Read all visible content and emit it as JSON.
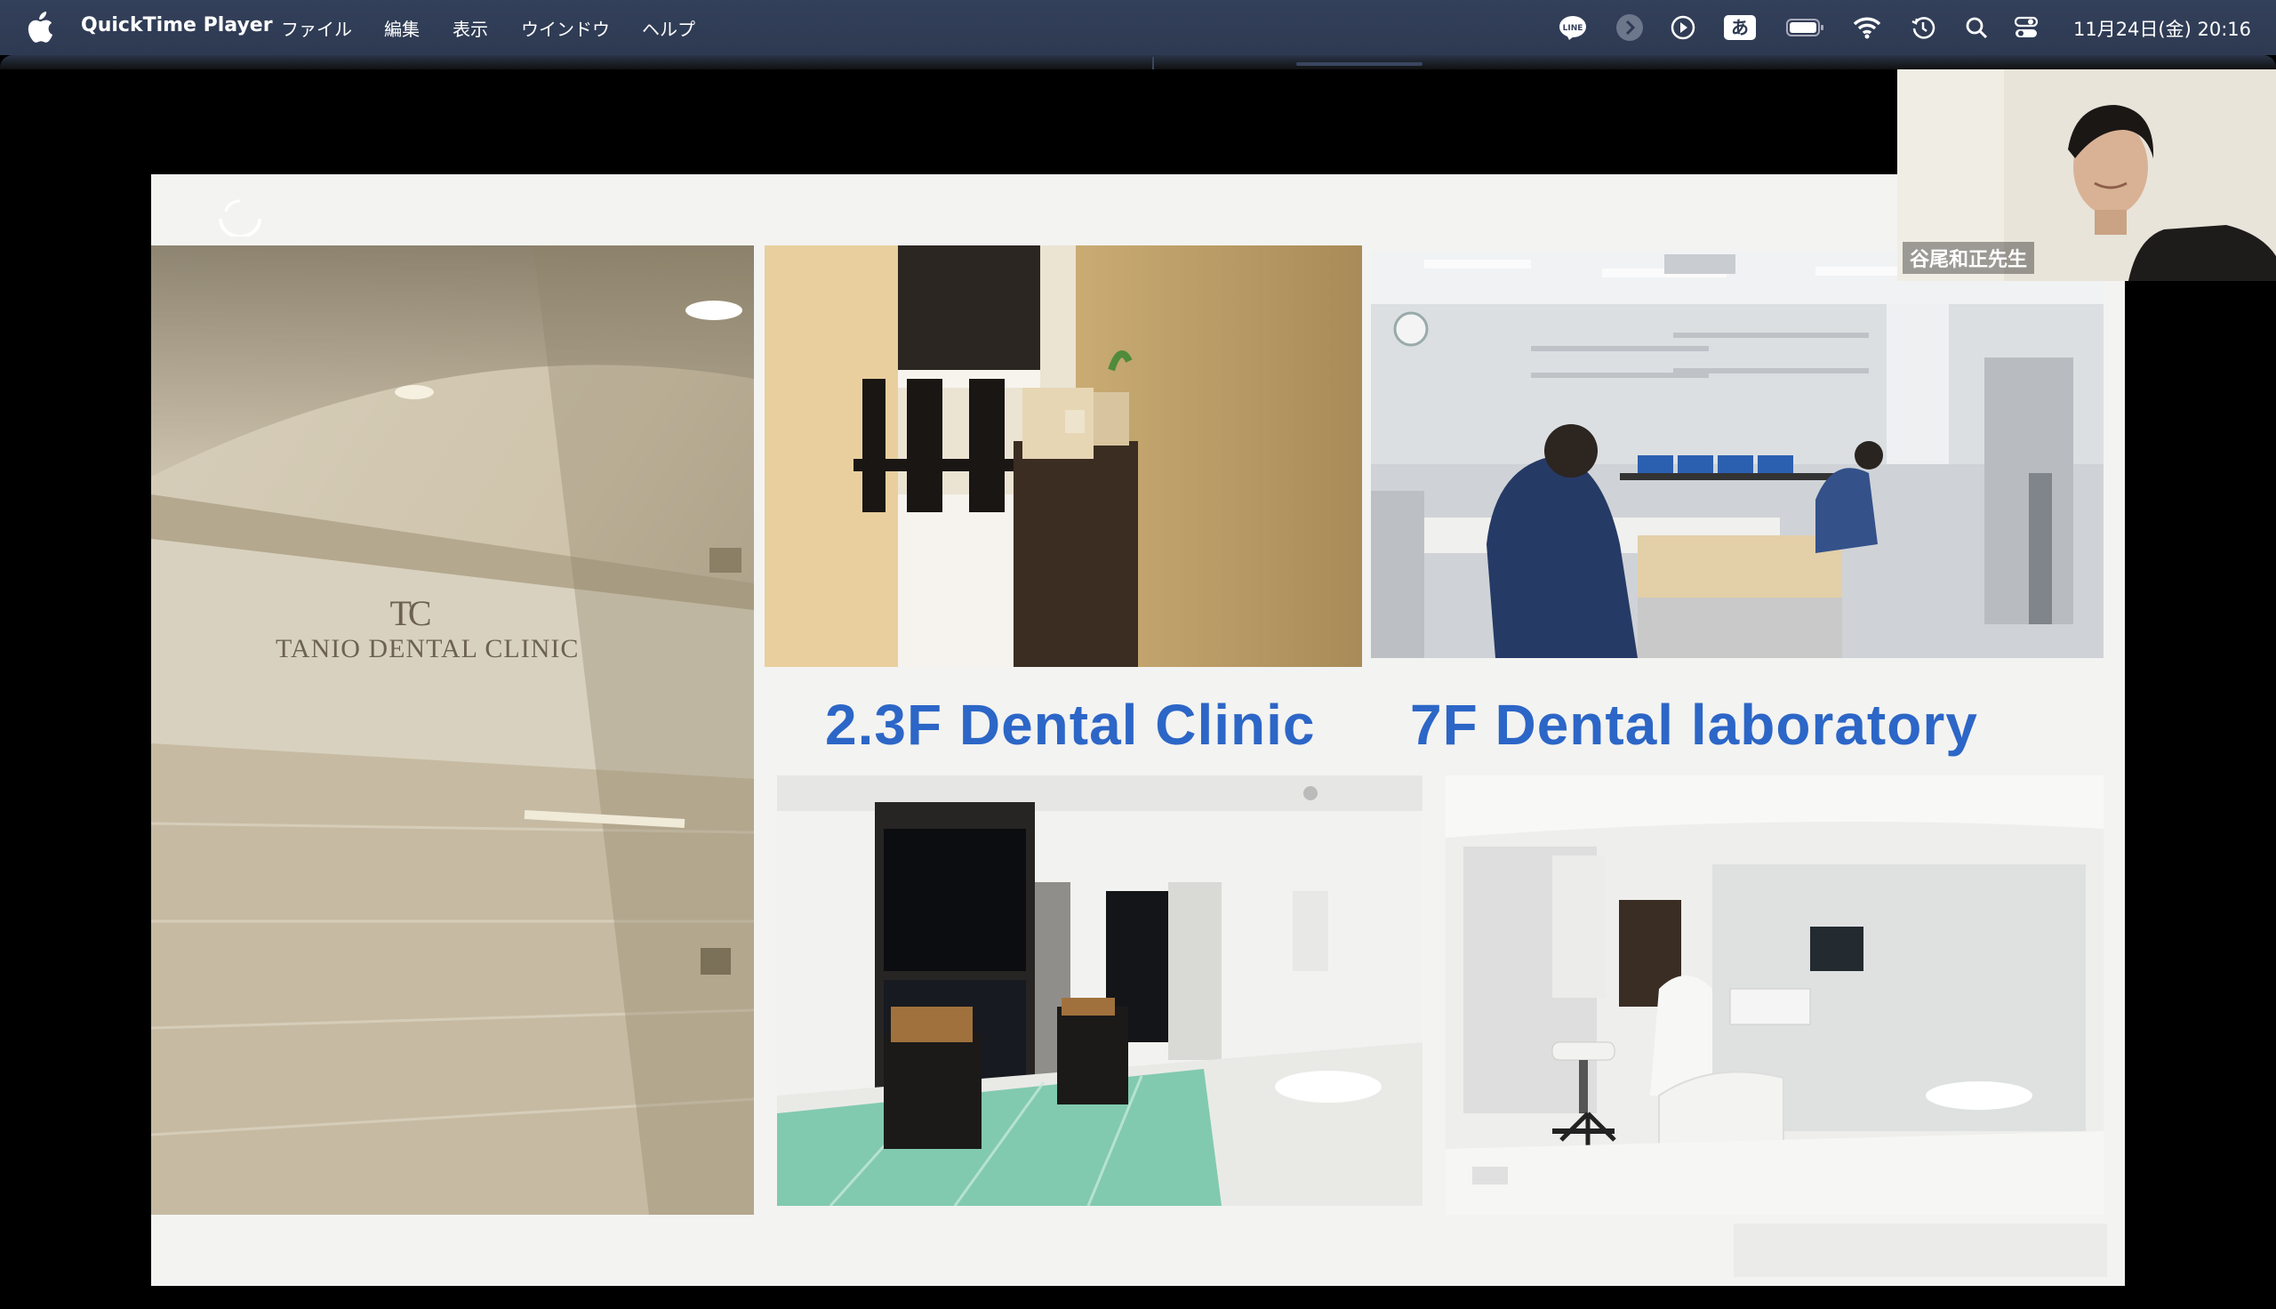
{
  "menubar": {
    "app_name": "QuickTime Player",
    "items": [
      "ファイル",
      "編集",
      "表示",
      "ウインドウ",
      "ヘルプ"
    ],
    "status_icons": [
      "line-icon",
      "forward-icon",
      "play-circle-icon",
      "input-method-icon",
      "battery-icon",
      "wifi-icon",
      "time-machine-icon",
      "search-icon",
      "control-center-icon"
    ],
    "input_method": "あ",
    "line_label": "LINE",
    "clock": "11月24日(金)  20:16"
  },
  "slide": {
    "sign_text": "TANIO DENTAL CLINIC",
    "sign_monogram": "TC",
    "caption_clinic": "2.3F Dental Clinic",
    "caption_lab": "7F Dental laboratory",
    "photos": [
      "entrance-hallway-photo",
      "waiting-room-photo",
      "dental-laboratory-photo",
      "lounge-photo",
      "treatment-room-photo"
    ]
  },
  "webcam": {
    "participant_name": "谷尾和正先生"
  }
}
